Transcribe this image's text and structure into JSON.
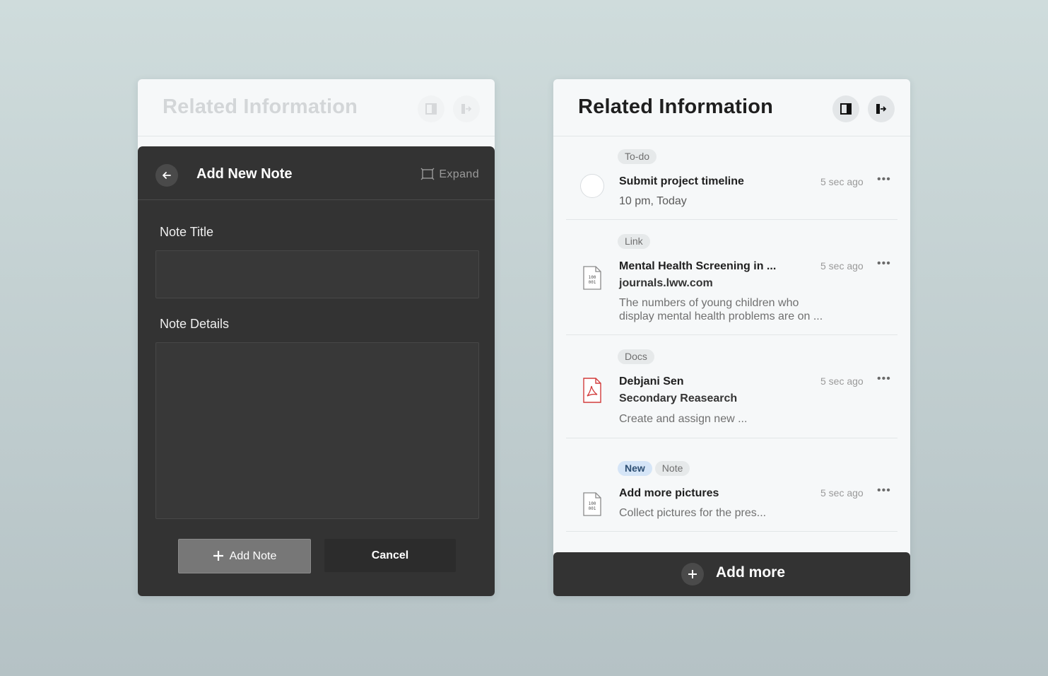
{
  "left_panel": {
    "title": "Related Information",
    "form": {
      "title": "Add New Note",
      "expand_label": "Expand",
      "note_title_label": "Note Title",
      "note_title_value": "",
      "note_details_label": "Note Details",
      "note_details_value": "",
      "add_button": "Add Note",
      "cancel_button": "Cancel"
    }
  },
  "right_panel": {
    "title": "Related Information",
    "items": [
      {
        "tags": [
          "To-do"
        ],
        "title": "Submit project timeline",
        "subtitle": "",
        "text": "10 pm, Today",
        "time": "5 sec ago",
        "icon": "checkbox-circle-icon"
      },
      {
        "tags": [
          "Link"
        ],
        "title": "Mental Health Screening in ...",
        "subtitle": "journals.lww.com",
        "text_line1": "The numbers of young children who",
        "text_line2": "display mental health problems are on  ...",
        "time": "5 sec ago",
        "icon": "binary-file-icon"
      },
      {
        "tags": [
          "Docs"
        ],
        "title": "Debjani Sen",
        "subtitle": "Secondary Reasearch",
        "text": "Create and assign new ...",
        "time": "5 sec ago",
        "icon": "pdf-file-icon"
      },
      {
        "tags": [
          "New",
          "Note"
        ],
        "title": "Add more pictures",
        "subtitle": "",
        "text": "Collect pictures for the pres...",
        "time": "5 sec ago",
        "icon": "binary-file-icon"
      }
    ],
    "add_more": "Add more"
  },
  "colors": {
    "dark": "#333333",
    "accent_new_chip": "#d5e5f7",
    "pdf_red": "#d23c3c"
  }
}
